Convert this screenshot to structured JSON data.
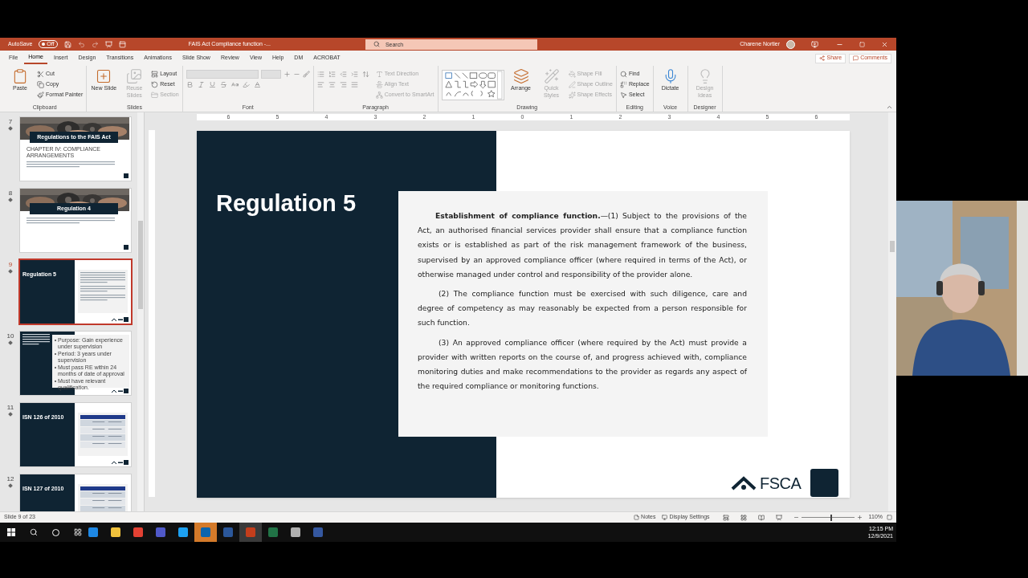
{
  "title_bar": {
    "autosave_label": "AutoSave",
    "autosave_state": "Off",
    "autosave_on": false,
    "document_title": "FAIS Act Compliance function -...",
    "search_placeholder": "Search",
    "user_name": "Charene Nortier"
  },
  "ribbon_tabs": [
    {
      "label": "File",
      "selected": false
    },
    {
      "label": "Home",
      "selected": true
    },
    {
      "label": "Insert",
      "selected": false
    },
    {
      "label": "Design",
      "selected": false
    },
    {
      "label": "Transitions",
      "selected": false
    },
    {
      "label": "Animations",
      "selected": false
    },
    {
      "label": "Slide Show",
      "selected": false
    },
    {
      "label": "Review",
      "selected": false
    },
    {
      "label": "View",
      "selected": false
    },
    {
      "label": "Help",
      "selected": false
    },
    {
      "label": "DM",
      "selected": false
    },
    {
      "label": "ACROBAT",
      "selected": false
    }
  ],
  "share_label": "Share",
  "comments_label": "Comments",
  "ribbon_groups": [
    {
      "name": "Clipboard",
      "items": [
        {
          "kind": "large",
          "label": "Paste",
          "disabled": false
        },
        {
          "kind": "small",
          "label": "Cut",
          "disabled": false
        },
        {
          "kind": "small",
          "label": "Copy",
          "disabled": false
        },
        {
          "kind": "small",
          "label": "Format Painter",
          "disabled": false
        }
      ]
    },
    {
      "name": "Slides",
      "items": [
        {
          "kind": "large",
          "label": "New Slide",
          "disabled": false
        },
        {
          "kind": "large",
          "label": "Reuse Slides",
          "disabled": true
        },
        {
          "kind": "small",
          "label": "Layout",
          "disabled": false
        },
        {
          "kind": "small",
          "label": "Reset",
          "disabled": false
        },
        {
          "kind": "small",
          "label": "Section",
          "disabled": true
        }
      ]
    },
    {
      "name": "Font"
    },
    {
      "name": "Paragraph",
      "items": [
        {
          "kind": "small",
          "label": "Text Direction",
          "disabled": true
        },
        {
          "kind": "small",
          "label": "Align Text",
          "disabled": true
        },
        {
          "kind": "small",
          "label": "Convert to SmartArt",
          "disabled": true
        }
      ]
    },
    {
      "name": "Drawing",
      "items": [
        {
          "kind": "large",
          "label": "Arrange",
          "disabled": false
        },
        {
          "kind": "large",
          "label": "Quick Styles",
          "disabled": true
        },
        {
          "kind": "small",
          "label": "Shape Fill",
          "disabled": true
        },
        {
          "kind": "small",
          "label": "Shape Outline",
          "disabled": true
        },
        {
          "kind": "small",
          "label": "Shape Effects",
          "disabled": true
        }
      ]
    },
    {
      "name": "Editing",
      "items": [
        {
          "kind": "small",
          "label": "Find",
          "disabled": false
        },
        {
          "kind": "small",
          "label": "Replace",
          "disabled": false
        },
        {
          "kind": "small",
          "label": "Select",
          "disabled": false
        }
      ]
    },
    {
      "name": "Voice",
      "items": [
        {
          "kind": "large",
          "label": "Dictate",
          "disabled": false
        }
      ]
    },
    {
      "name": "Designer",
      "items": [
        {
          "kind": "large",
          "label": "Design Ideas",
          "disabled": true
        }
      ]
    }
  ],
  "thumbnails": [
    {
      "number": "7",
      "selected": false,
      "title": "Regulations to the FAIS Act",
      "subtitle": "CHAPTER IV: COMPLIANCE ARRANGEMENTS"
    },
    {
      "number": "8",
      "selected": false,
      "title": "Regulation 4"
    },
    {
      "number": "9",
      "selected": true,
      "kind": "split",
      "title": "Regulation 5"
    },
    {
      "number": "10",
      "selected": false,
      "kind": "bullets",
      "bullets": [
        "Purpose: Gain experience under supervision",
        "Period: 3 years under supervision",
        "Must pass RE within 24 months of date of approval",
        "Must have relevant qualification."
      ]
    },
    {
      "number": "11",
      "selected": false,
      "kind": "table",
      "title": "ISN 126 of 2010"
    },
    {
      "number": "12",
      "selected": false,
      "kind": "table",
      "title": "ISN 127 of 2010"
    }
  ],
  "ruler_labels": [
    "6",
    "5",
    "4",
    "3",
    "2",
    "1",
    "0",
    "1",
    "2",
    "3",
    "4",
    "5",
    "6"
  ],
  "slide": {
    "title": "Regulation 5",
    "paragraphs": [
      "**Establishment of compliance function.**—(1) Subject to the provisions of the Act, an authorised financial services provider shall ensure that a compliance function exists or is established as part of the risk management framework of the business, supervised by an approved compliance officer (where required in terms of the Act), or otherwise managed under control and responsibility of the provider alone.",
      "(2) The compliance function must be exercised with such diligence, care and degree of competency as may reasonably be expected from a person responsible for such function.",
      "(3) An approved compliance officer (where required by the Act) must provide a provider with written reports on the course of, and progress achieved with, compliance monitoring duties and make recommendations to the provider as regards any aspect of the required compliance or monitoring functions."
    ],
    "logo_text": "FSCA"
  },
  "status_bar": {
    "slide_info": "Slide 9 of 23",
    "notes_label": "Notes",
    "display_label": "Display Settings",
    "zoom_label": "110%",
    "zoom": {
      "level": 0.55
    }
  },
  "taskbar": {
    "time": "12:15 PM",
    "date": "12/9/2021"
  }
}
